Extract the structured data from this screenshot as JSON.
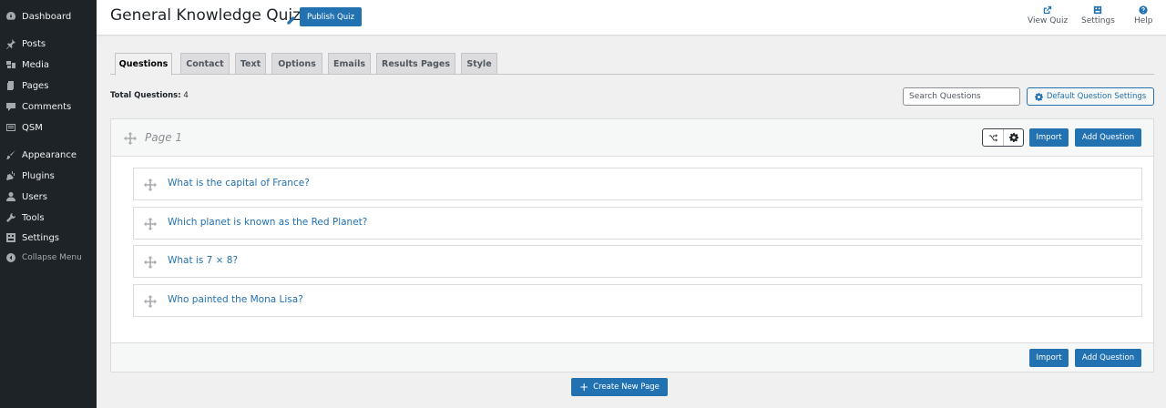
{
  "sidebar": {
    "items": [
      {
        "label": "Dashboard",
        "icon": "dashboard-icon"
      },
      {
        "label": "Posts",
        "icon": "pin-icon"
      },
      {
        "label": "Media",
        "icon": "media-icon"
      },
      {
        "label": "Pages",
        "icon": "pages-icon"
      },
      {
        "label": "Comments",
        "icon": "comment-icon"
      },
      {
        "label": "QSM",
        "icon": "qsm-icon"
      },
      {
        "label": "Appearance",
        "icon": "brush-icon"
      },
      {
        "label": "Plugins",
        "icon": "plug-icon"
      },
      {
        "label": "Users",
        "icon": "user-icon"
      },
      {
        "label": "Tools",
        "icon": "wrench-icon"
      },
      {
        "label": "Settings",
        "icon": "settings-icon"
      },
      {
        "label": "Collapse Menu",
        "icon": "collapse-icon"
      }
    ]
  },
  "header": {
    "title": "General Knowledge Quiz",
    "publish_label": "Publish Quiz",
    "view_quiz_label": "View Quiz",
    "settings_label": "Settings",
    "help_label": "Help"
  },
  "tabs": [
    {
      "label": "Questions",
      "active": true
    },
    {
      "label": "Contact",
      "active": false
    },
    {
      "label": "Text",
      "active": false
    },
    {
      "label": "Options",
      "active": false
    },
    {
      "label": "Emails",
      "active": false
    },
    {
      "label": "Results Pages",
      "active": false
    },
    {
      "label": "Style",
      "active": false
    }
  ],
  "toolbar": {
    "total_label": "Total Questions:",
    "total_count": "4",
    "search_placeholder": "Search Questions",
    "default_settings_label": "Default Question Settings"
  },
  "page": {
    "label": "Page 1",
    "import_label": "Import",
    "add_question_label": "Add Question",
    "questions": [
      "What is the capital of France?",
      "Which planet is known as the Red Planet?",
      "What is 7 × 8?",
      "Who painted the Mona Lisa?"
    ]
  },
  "create_page_label": "Create New Page",
  "colors": {
    "accent": "#2271b1",
    "sidebar_bg": "#1d2327",
    "page_bg": "#f0f0f1"
  }
}
